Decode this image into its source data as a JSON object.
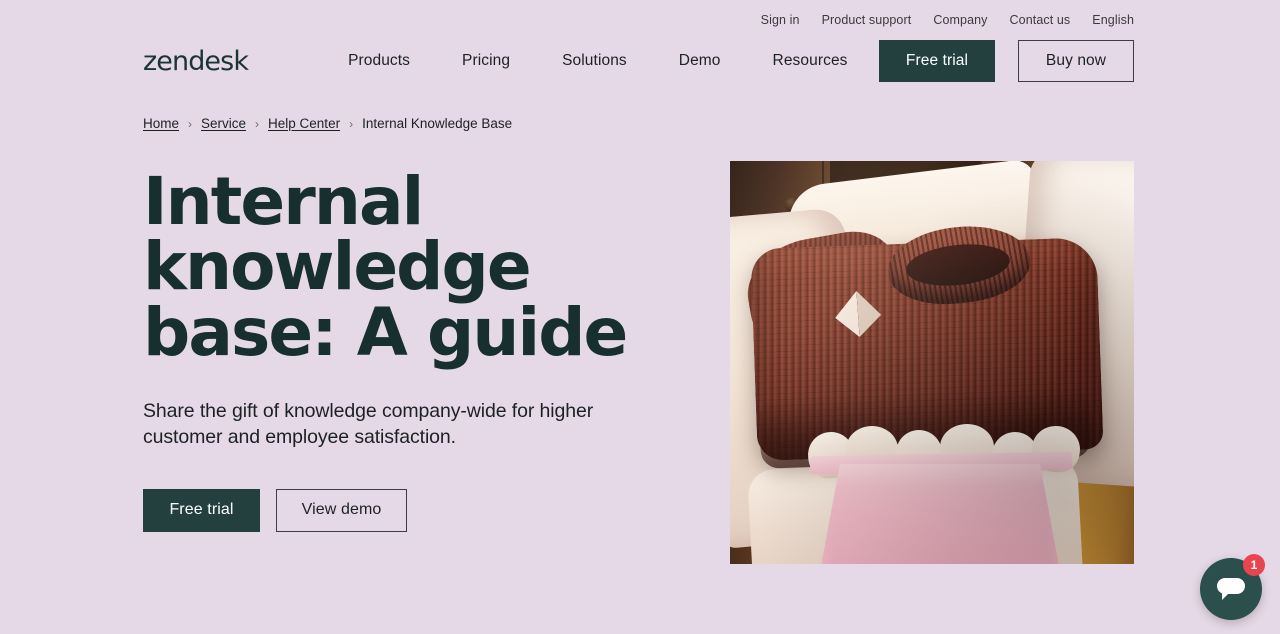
{
  "brand": {
    "logo_text": "zendesk",
    "accent_dark": "#23403F",
    "page_background": "#E6D9E7",
    "heading_color": "#17302F",
    "badge_red": "#E8454F"
  },
  "utility_nav": {
    "items": [
      {
        "label": "Sign in"
      },
      {
        "label": "Product support"
      },
      {
        "label": "Company"
      },
      {
        "label": "Contact us"
      },
      {
        "label": "English"
      }
    ]
  },
  "main_nav": {
    "links": [
      {
        "label": "Products"
      },
      {
        "label": "Pricing"
      },
      {
        "label": "Solutions"
      },
      {
        "label": "Demo"
      },
      {
        "label": "Resources"
      }
    ],
    "free_trial_label": "Free trial",
    "buy_now_label": "Buy now"
  },
  "breadcrumb": {
    "separator": "›",
    "items": [
      {
        "label": "Home",
        "is_link": true
      },
      {
        "label": "Service",
        "is_link": true
      },
      {
        "label": "Help Center",
        "is_link": true
      },
      {
        "label": "Internal Knowledge Base",
        "is_link": false
      }
    ]
  },
  "hero": {
    "title": "Internal knowledge base: A guide",
    "subtitle": "Share the gift of knowledge company-wide for higher customer and employee satisfaction.",
    "primary_cta": "Free trial",
    "secondary_cta": "View demo",
    "image_alt": "Rust-colored knit sweater folded in a pink gift box with white tissue paper"
  },
  "chat_widget": {
    "badge_count": "1",
    "icon": "chat-bubble-icon"
  }
}
